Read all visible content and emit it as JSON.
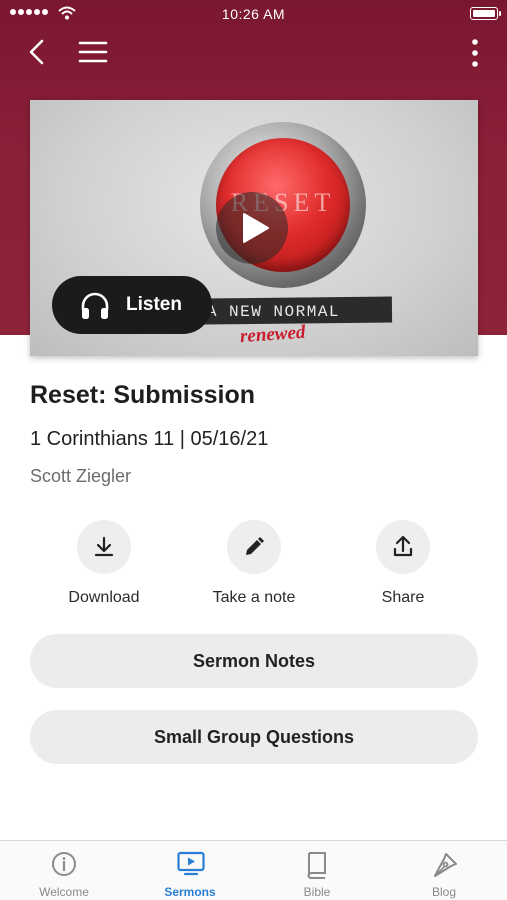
{
  "status_bar": {
    "time": "10:26 AM"
  },
  "colors": {
    "header": "#8a1f38",
    "accent": "#2a7fd4",
    "button_bg": "#ececee"
  },
  "header": {
    "back_icon": "chevron-left-icon",
    "menu_icon": "hamburger-icon",
    "more_icon": "vertical-dots-icon"
  },
  "artwork": {
    "button_text": "RESET",
    "tape_text": "BACK TO A NEW NORMAL",
    "handwritten_text": "renewed",
    "play_icon": "play-icon",
    "listen_label": "Listen",
    "listen_icon": "headphones-icon"
  },
  "sermon": {
    "title": "Reset: Submission",
    "subtitle": "1 Corinthians 11 | 05/16/21",
    "speaker": "Scott Ziegler"
  },
  "actions": [
    {
      "label": "Download",
      "icon": "download-icon"
    },
    {
      "label": "Take a note",
      "icon": "pencil-icon"
    },
    {
      "label": "Share",
      "icon": "share-icon"
    }
  ],
  "buttons": {
    "notes": "Sermon Notes",
    "questions": "Small Group Questions"
  },
  "tabs": [
    {
      "label": "Welcome",
      "icon": "info-icon",
      "active": false
    },
    {
      "label": "Sermons",
      "icon": "tv-play-icon",
      "active": true
    },
    {
      "label": "Bible",
      "icon": "book-icon",
      "active": false
    },
    {
      "label": "Blog",
      "icon": "pen-nib-icon",
      "active": false
    }
  ]
}
